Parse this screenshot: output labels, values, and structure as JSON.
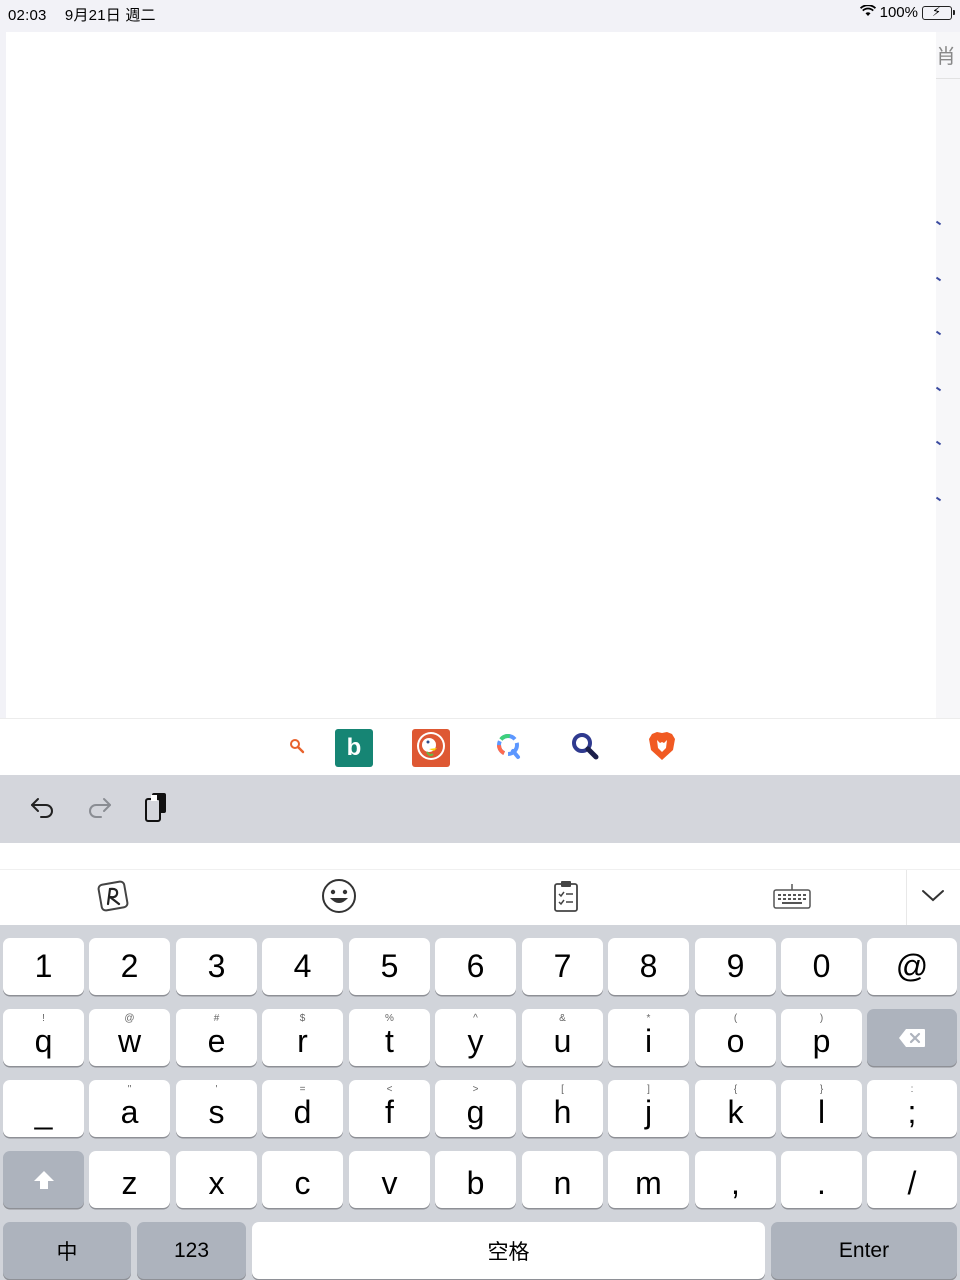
{
  "status": {
    "time": "02:03",
    "date": "9月21日 週二",
    "battery": "100%"
  },
  "side": {
    "hint": "肖"
  },
  "engines": [
    {
      "name": "search",
      "label": ""
    },
    {
      "name": "bing",
      "label": "b"
    },
    {
      "name": "duckduckgo",
      "label": ""
    },
    {
      "name": "qwant",
      "label": ""
    },
    {
      "name": "search-alt",
      "label": ""
    },
    {
      "name": "brave",
      "label": ""
    }
  ],
  "toolbar": {
    "undo": "undo",
    "redo": "redo",
    "paste": "paste"
  },
  "keyboard": {
    "row_numbers": [
      "1",
      "2",
      "3",
      "4",
      "5",
      "6",
      "7",
      "8",
      "9",
      "0",
      "@"
    ],
    "row1": [
      {
        "sub": "!",
        "main": "q"
      },
      {
        "sub": "@",
        "main": "w"
      },
      {
        "sub": "#",
        "main": "e"
      },
      {
        "sub": "$",
        "main": "r"
      },
      {
        "sub": "%",
        "main": "t"
      },
      {
        "sub": "^",
        "main": "y"
      },
      {
        "sub": "&",
        "main": "u"
      },
      {
        "sub": "*",
        "main": "i"
      },
      {
        "sub": "(",
        "main": "o"
      },
      {
        "sub": ")",
        "main": "p"
      }
    ],
    "row2": [
      {
        "sub": "",
        "main": "_"
      },
      {
        "sub": "\"",
        "main": "a"
      },
      {
        "sub": "'",
        "main": "s"
      },
      {
        "sub": "=",
        "main": "d"
      },
      {
        "sub": "<",
        "main": "f"
      },
      {
        "sub": ">",
        "main": "g"
      },
      {
        "sub": "[",
        "main": "h"
      },
      {
        "sub": "]",
        "main": "j"
      },
      {
        "sub": "{",
        "main": "k"
      },
      {
        "sub": "}",
        "main": "l"
      },
      {
        "sub": ":",
        "main": ";"
      }
    ],
    "row3": [
      {
        "sub": "",
        "main": "z"
      },
      {
        "sub": "",
        "main": "x"
      },
      {
        "sub": "",
        "main": "c"
      },
      {
        "sub": "",
        "main": "v"
      },
      {
        "sub": "",
        "main": "b"
      },
      {
        "sub": "",
        "main": "n"
      },
      {
        "sub": "",
        "main": "m"
      },
      {
        "sub": "",
        "main": ","
      },
      {
        "sub": "",
        "main": "."
      },
      {
        "sub": "",
        "main": "/"
      }
    ],
    "chinese_label": "中",
    "numbers_label": "123",
    "space_label": "空格",
    "enter_label": "Enter"
  }
}
